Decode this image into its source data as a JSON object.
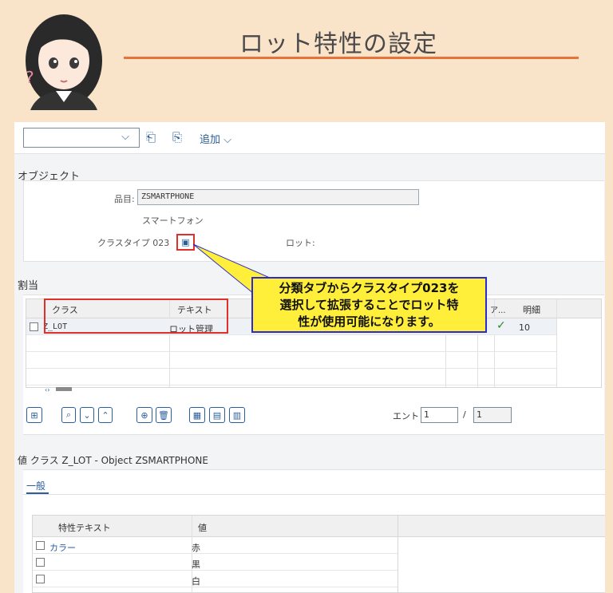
{
  "header": {
    "title": "ロット特性の設定"
  },
  "toolbar": {
    "select_value": "",
    "icons": [
      "paste-icon",
      "export-icon"
    ],
    "add_label": "追加"
  },
  "object": {
    "section_label": "オブジェクト",
    "material_label": "品目:",
    "material_value": "ZSMARTPHONE",
    "material_desc": "スマートフォン",
    "class_type_label": "クラスタイプ 023",
    "lot_label": "ロット:"
  },
  "assignment": {
    "section_label": "割当",
    "columns": [
      "クラス",
      "テキスト",
      "ア...",
      "明細"
    ],
    "rows": [
      {
        "class": "Z_LOT",
        "text": "ロット管理",
        "status": "✓",
        "item": "10"
      }
    ]
  },
  "callout": {
    "lines": [
      "分類タブからクラスタイプ023を",
      "選択して拡張することでロット特",
      "性が使用可能になります。"
    ]
  },
  "entries": {
    "label": "エントリ",
    "current": "1",
    "separator": "/",
    "total": "1"
  },
  "values": {
    "section_label": "値 クラス Z_LOT - Object ZSMARTPHONE",
    "tab_general": "一般",
    "columns": [
      "特性テキスト",
      "値"
    ],
    "rows": [
      {
        "char": "カラー",
        "value": "赤"
      },
      {
        "char": "",
        "value": "黒"
      },
      {
        "char": "",
        "value": "白"
      }
    ]
  },
  "colors": {
    "accent": "#2b5e9a",
    "highlight": "#e0302a",
    "callout_bg": "#ffee3a",
    "page_bg": "#f9e3c9"
  }
}
